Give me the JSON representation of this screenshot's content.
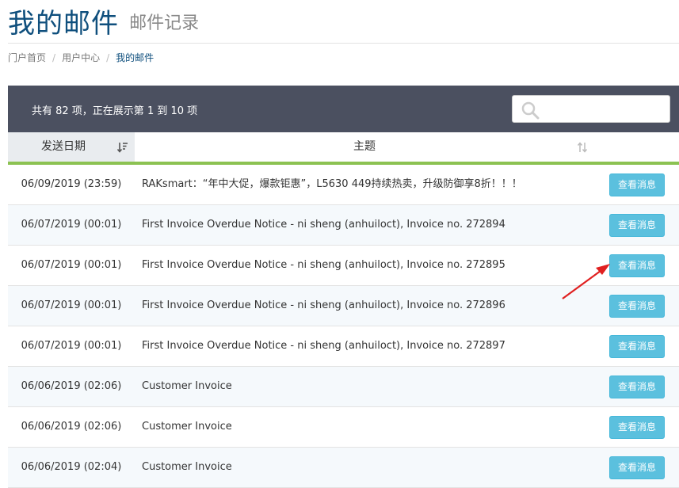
{
  "header": {
    "title": "我的邮件",
    "subtitle": "邮件记录"
  },
  "breadcrumb": [
    "门户首页",
    "用户中心",
    "我的邮件"
  ],
  "toolbar": {
    "info": "共有 82 项，正在展示第 1 到 10 项",
    "search_placeholder": ""
  },
  "table": {
    "columns": [
      "发送日期",
      "主题"
    ],
    "button_label": "查看消息",
    "rows": [
      {
        "date": "06/09/2019 (23:59)",
        "subject": "RAKsmart：“年中大促，爆款钜惠”，L5630 449持续热卖，升级防御享8折！！！"
      },
      {
        "date": "06/07/2019 (00:01)",
        "subject": "First Invoice Overdue Notice - ni sheng (anhuiloct), Invoice no. 272894"
      },
      {
        "date": "06/07/2019 (00:01)",
        "subject": "First Invoice Overdue Notice - ni sheng (anhuiloct), Invoice no. 272895"
      },
      {
        "date": "06/07/2019 (00:01)",
        "subject": "First Invoice Overdue Notice - ni sheng (anhuiloct), Invoice no. 272896"
      },
      {
        "date": "06/07/2019 (00:01)",
        "subject": "First Invoice Overdue Notice - ni sheng (anhuiloct), Invoice no. 272897"
      },
      {
        "date": "06/06/2019 (02:06)",
        "subject": "Customer Invoice"
      },
      {
        "date": "06/06/2019 (02:06)",
        "subject": "Customer Invoice"
      },
      {
        "date": "06/06/2019 (02:04)",
        "subject": "Customer Invoice"
      }
    ]
  },
  "colors": {
    "title": "#0f4f7d",
    "toolbar_bg": "#4b5060",
    "accent_green": "#8cc252",
    "button": "#5bc0de",
    "arrow": "#e02020"
  }
}
